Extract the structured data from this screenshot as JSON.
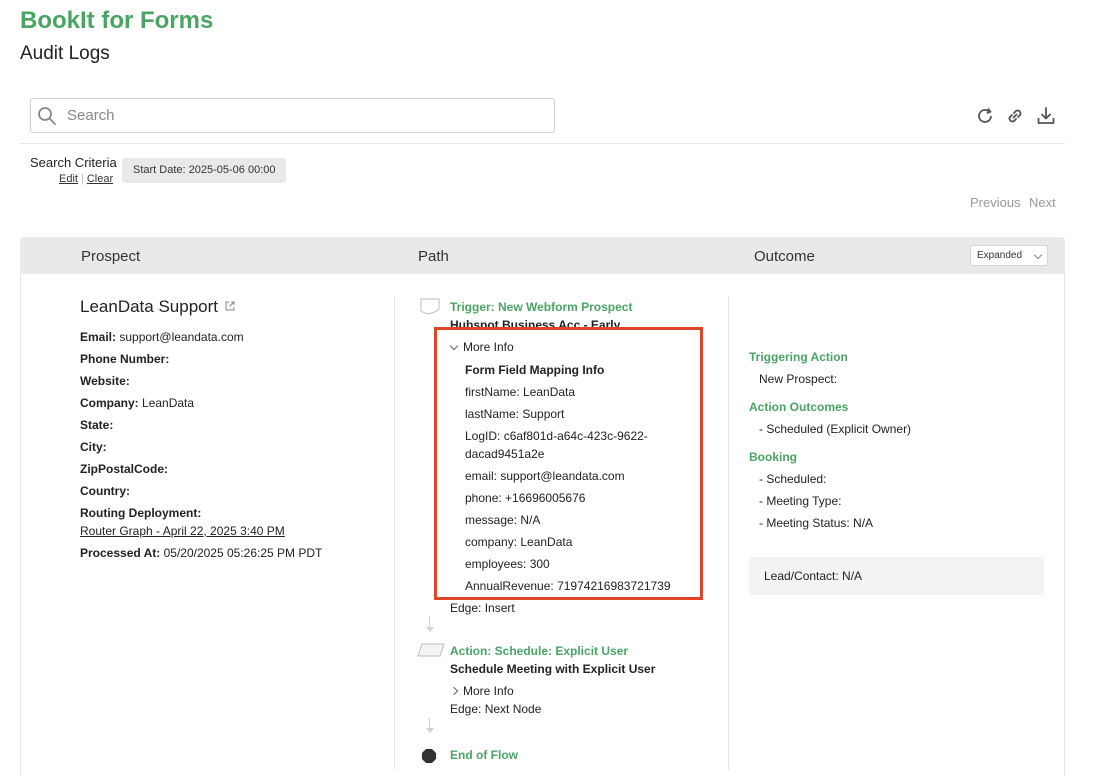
{
  "header": {
    "app_title": "BookIt for Forms",
    "page_title": "Audit Logs"
  },
  "search": {
    "placeholder": "Search"
  },
  "toolbar": {
    "icons": [
      "refresh-icon",
      "link-icon",
      "download-icon"
    ]
  },
  "criteria": {
    "label": "Search Criteria",
    "edit": "Edit",
    "clear": "Clear",
    "chip": "Start Date: 2025-05-06 00:00"
  },
  "pager": {
    "previous": "Previous",
    "next": "Next"
  },
  "table": {
    "columns": {
      "prospect": "Prospect",
      "path": "Path",
      "outcome": "Outcome"
    },
    "view_mode": "Expanded"
  },
  "prospect": {
    "name": "LeanData Support",
    "fields": [
      {
        "label": "Email:",
        "value": "support@leandata.com"
      },
      {
        "label": "Phone Number:",
        "value": ""
      },
      {
        "label": "Website:",
        "value": ""
      },
      {
        "label": "Company:",
        "value": "LeanData"
      },
      {
        "label": "State:",
        "value": ""
      },
      {
        "label": "City:",
        "value": ""
      },
      {
        "label": "ZipPostalCode:",
        "value": ""
      },
      {
        "label": "Country:",
        "value": ""
      },
      {
        "label": "Routing Deployment:",
        "value": ""
      }
    ],
    "deployment_link": "Router Graph - April 22, 2025 3:40 PM",
    "processed_label": "Processed At:",
    "processed_value": "05/20/2025 05:26:25 PM PDT"
  },
  "path": {
    "trigger": {
      "label": "Trigger: New Webform Prospect",
      "sub": "Hubspot Business Acc - Early",
      "more_info": "More Info",
      "mapping_title": "Form Field Mapping Info",
      "mapping": [
        "firstName: LeanData",
        "lastName: Support",
        "LogID: c6af801d-a64c-423c-9622-",
        "dacad9451a2e",
        "email: support@leandata.com",
        "phone: +16696005676",
        "message: N/A",
        "company: LeanData",
        "employees: 300",
        "AnnualRevenue: 71974216983721739"
      ],
      "edge": "Edge: Insert"
    },
    "action": {
      "label": "Action: Schedule: Explicit User",
      "sub": "Schedule Meeting with Explicit User",
      "more_info": "More Info",
      "edge": "Edge: Next Node"
    },
    "end": {
      "label": "End of Flow"
    }
  },
  "outcome": {
    "triggering_action": {
      "title": "Triggering Action",
      "items": [
        "New Prospect:"
      ]
    },
    "action_outcomes": {
      "title": "Action Outcomes",
      "items": [
        "- Scheduled (Explicit Owner)"
      ]
    },
    "booking": {
      "title": "Booking",
      "items": [
        "- Scheduled:",
        "- Meeting Type:",
        "- Meeting Status: N/A"
      ]
    },
    "lead_contact": "Lead/Contact: N/A"
  },
  "colors": {
    "accent": "#4aa564",
    "highlight": "#e0452a",
    "header_bg": "#e9e9e9"
  }
}
